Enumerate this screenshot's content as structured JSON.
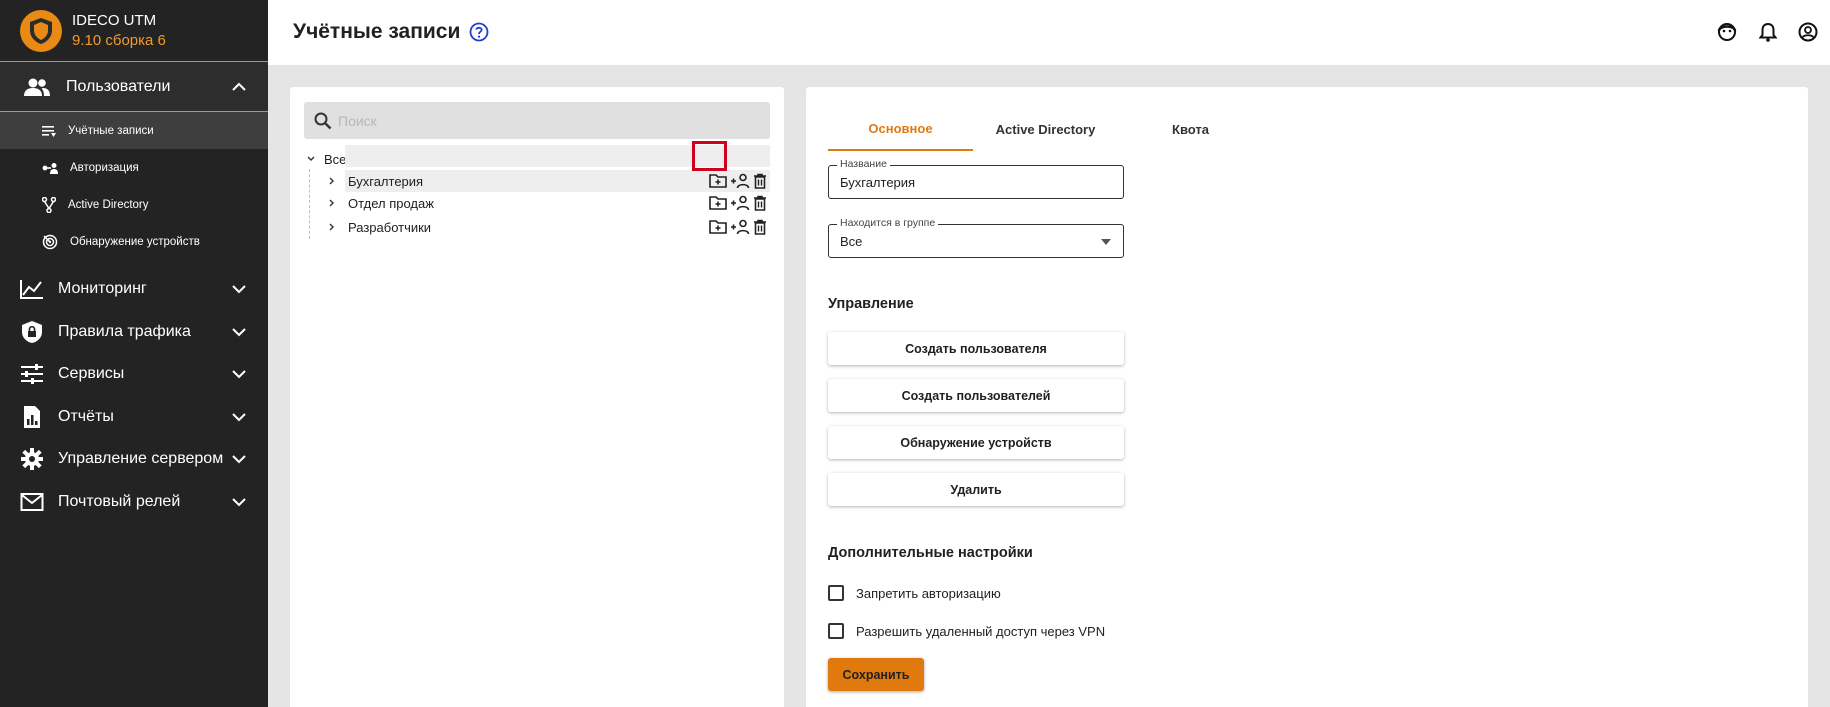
{
  "brand": {
    "name": "IDECO UTM",
    "version": "9.10 сборка 6"
  },
  "sidebar": {
    "group": {
      "label": "Пользователи"
    },
    "subitems": [
      {
        "label": "Учётные записи",
        "icon": "list-icon"
      },
      {
        "label": "Авторизация",
        "icon": "key-user-icon"
      },
      {
        "label": "Active Directory",
        "icon": "fork-icon"
      },
      {
        "label": "Обнаружение устройств",
        "icon": "radar-icon"
      }
    ],
    "items": [
      {
        "label": "Мониторинг",
        "icon": "chart-line-icon"
      },
      {
        "label": "Правила трафика",
        "icon": "shield-lock-icon"
      },
      {
        "label": "Сервисы",
        "icon": "sliders-icon"
      },
      {
        "label": "Отчёты",
        "icon": "report-icon"
      },
      {
        "label": "Управление сервером",
        "icon": "gear-icon"
      },
      {
        "label": "Почтовый релей",
        "icon": "mail-icon"
      }
    ]
  },
  "header": {
    "title": "Учётные записи"
  },
  "tree": {
    "search_placeholder": "Поиск",
    "root": "Все",
    "groups": [
      {
        "label": "Бухгалтерия"
      },
      {
        "label": "Отдел продаж"
      },
      {
        "label": "Разработчики"
      }
    ]
  },
  "form": {
    "tabs": [
      "Основное",
      "Active Directory",
      "Квота"
    ],
    "name_label": "Название",
    "name_value": "Бухгалтерия",
    "group_label": "Находится в группе",
    "group_value": "Все",
    "management_title": "Управление",
    "buttons": {
      "create_user": "Создать пользователя",
      "create_users": "Создать пользователей",
      "discover": "Обнаружение устройств",
      "delete": "Удалить"
    },
    "extra_title": "Дополнительные настройки",
    "checkboxes": {
      "deny_auth": "Запретить авторизацию",
      "allow_vpn": "Разрешить удаленный доступ через VPN"
    },
    "save": "Сохранить"
  },
  "colors": {
    "accent": "#e07a0f",
    "sidebar_bg": "#232323",
    "brand_version": "#f19a2b"
  }
}
